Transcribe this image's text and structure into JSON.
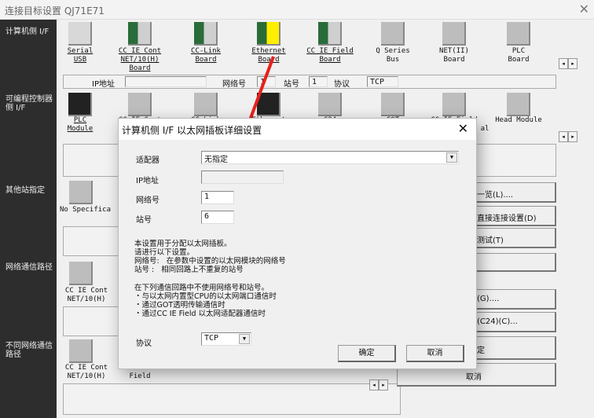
{
  "window": {
    "title": "连接目标设置 QJ71E71",
    "close": "✕"
  },
  "sidebar": [
    "计算机侧 I/F",
    "可编程控制器侧 I/F",
    "其他站指定",
    "网络通信路径",
    "不同网络通信路径"
  ],
  "pc_if": [
    {
      "l1": "Serial",
      "l2": "USB",
      "l3": "",
      "icon": "serial-usb-icon"
    },
    {
      "l1": "CC IE Cont",
      "l2": "NET/10(H)",
      "l3": "Board",
      "icon": "cc-ie-cont-board-icon"
    },
    {
      "l1": "CC-Link",
      "l2": "Board",
      "l3": "",
      "icon": "cc-link-board-icon"
    },
    {
      "l1": "Ethernet",
      "l2": "Board",
      "l3": "",
      "icon": "ethernet-board-icon"
    },
    {
      "l1": "CC IE Field",
      "l2": "Board",
      "l3": "",
      "icon": "cc-ie-field-board-icon"
    },
    {
      "l1": "Q Series",
      "l2": "Bus",
      "l3": "",
      "icon": "q-series-bus-icon"
    },
    {
      "l1": "NET(II)",
      "l2": "Board",
      "l3": "",
      "icon": "net-ii-board-icon"
    },
    {
      "l1": "PLC",
      "l2": "Board",
      "l3": "",
      "icon": "plc-board-icon"
    }
  ],
  "info_bar": {
    "ip_label": "IP地址",
    "ip_value": "",
    "net_label": "网络号",
    "net_value": "1",
    "station_label": "站号",
    "station_value": "1",
    "protocol_label": "协议",
    "protocol_value": "TCP"
  },
  "plc_if": [
    {
      "l1": "PLC",
      "l2": "Module"
    },
    {
      "l1": "CC IE Cont",
      "l2": ""
    },
    {
      "l1": "CC-Link",
      "l2": ""
    },
    {
      "l1": "Ethernet",
      "l2": ""
    },
    {
      "l1": "C24",
      "l2": ""
    },
    {
      "l1": "GOT",
      "l2": ""
    },
    {
      "l1": "CC IE Field",
      "l2": "al"
    },
    {
      "l1": "Head Module",
      "l2": ""
    }
  ],
  "other_station": {
    "label": "No Specifica"
  },
  "network_route": {
    "l1": "CC IE Cont",
    "l2": "NET/10(H)"
  },
  "diff_network": {
    "l1": "CC IE Cont",
    "l2": "NET/10(H)",
    "l3": "Field"
  },
  "right_buttons": [
    "一览(L)....",
    "直接连接设置(D)",
    "测试(T)",
    "",
    "(G)....",
    "(C24)(C)...",
    "定",
    "取消"
  ],
  "dialog": {
    "title": "计算机侧 I/F 以太网插板详细设置",
    "close": "✕",
    "adapter_label": "适配器",
    "adapter_value": "无指定",
    "ip_label": "IP地址",
    "ip_value": "",
    "net_label": "网络号",
    "net_value": "1",
    "station_label": "站号",
    "station_value": "6",
    "note1": "本设置用于分配以太网插板。\n请进行以下设置。\n网络号:   在参数中设置的以太网模块的网络号\n站号 :   相同回路上不重复的站号",
    "note2": "在下列通信回路中不使用网络号和站号。\n・与以太网内置型CPU的以太网端口通信时\n・通过GOT透明传输通信时\n・通过CC IE Field 以太网适配器通信时",
    "protocol_label": "协议",
    "protocol_value": "TCP",
    "ok": "确定",
    "cancel": "取消"
  },
  "colors": {
    "annotation_arrow": "#e8201a",
    "highlight": "#ffee00"
  }
}
